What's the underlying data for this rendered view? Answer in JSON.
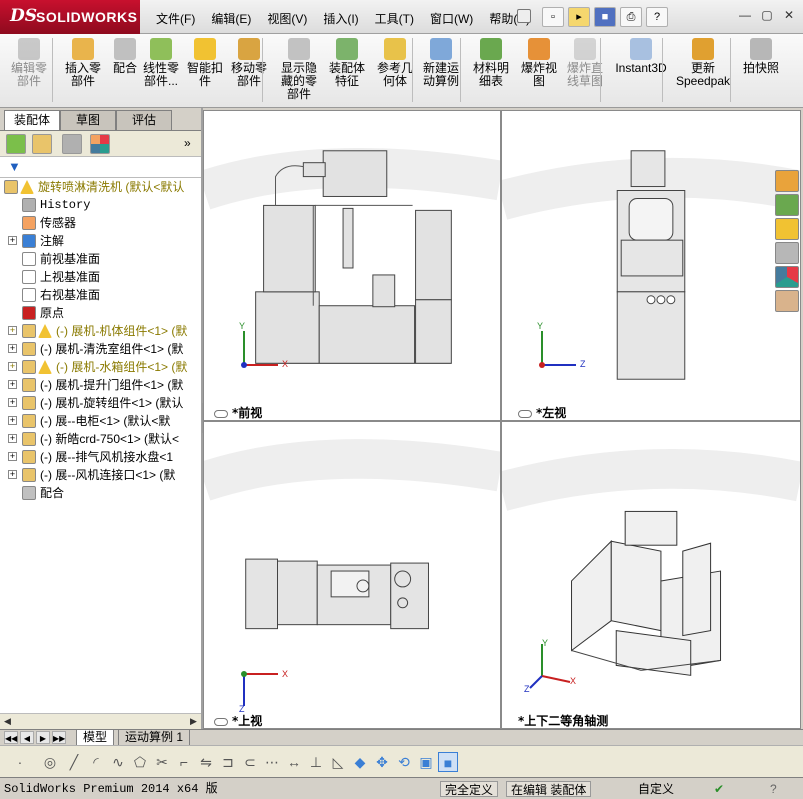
{
  "app": {
    "logo_ds": "DS",
    "logo_name": "SOLIDWORKS"
  },
  "menu": [
    "文件(F)",
    "编辑(E)",
    "视图(V)",
    "插入(I)",
    "工具(T)",
    "窗口(W)",
    "帮助(H)"
  ],
  "quick_access": [
    "new-icon",
    "open-icon",
    "save-icon",
    "print-icon",
    "help-icon"
  ],
  "window_controls": {
    "minimize": "—",
    "restore": "▢",
    "close": "✕"
  },
  "commands": [
    {
      "label": "编辑零\n部件",
      "icon": "edit-part-icon",
      "disabled": true
    },
    {
      "label": "插入零\n部件",
      "icon": "insert-part-icon",
      "disabled": false
    },
    {
      "label": "配合",
      "icon": "mate-icon",
      "disabled": false
    },
    {
      "label": "线性零\n部件...",
      "icon": "linear-pattern-icon",
      "disabled": false
    },
    {
      "label": "智能扣\n件",
      "icon": "smart-fastener-icon",
      "disabled": false
    },
    {
      "label": "移动零\n部件",
      "icon": "move-part-icon",
      "disabled": false
    },
    {
      "label": "显示隐\n藏的零\n部件",
      "icon": "show-hidden-icon",
      "disabled": false
    },
    {
      "label": "装配体\n特征",
      "icon": "assembly-feature-icon",
      "disabled": false
    },
    {
      "label": "参考几\n何体",
      "icon": "reference-geometry-icon",
      "disabled": false
    },
    {
      "label": "新建运\n动算例",
      "icon": "new-motion-study-icon",
      "disabled": false
    },
    {
      "label": "材料明\n细表",
      "icon": "bom-icon",
      "disabled": false
    },
    {
      "label": "爆炸视\n图",
      "icon": "exploded-view-icon",
      "disabled": false
    },
    {
      "label": "爆炸直\n线草图",
      "icon": "explode-line-sketch-icon",
      "disabled": true
    },
    {
      "label": "Instant3D",
      "icon": "instant3d-icon",
      "disabled": false
    },
    {
      "label": "更新\nSpeedpak",
      "icon": "speedpak-icon",
      "disabled": false
    },
    {
      "label": "拍快照",
      "icon": "snapshot-icon",
      "disabled": false
    }
  ],
  "left_tabs": [
    "装配体",
    "草图",
    "评估"
  ],
  "feature_tree": [
    {
      "label": "旋转喷淋清洗机  (默认<默认",
      "icon": "assembly-icon",
      "warn": true,
      "expand": false,
      "level": 0,
      "mono": false
    },
    {
      "label": "History",
      "icon": "history-icon",
      "warn": false,
      "expand": false,
      "level": 1,
      "mono": true
    },
    {
      "label": "传感器",
      "icon": "sensor-icon",
      "warn": false,
      "expand": false,
      "level": 1,
      "mono": false
    },
    {
      "label": "注解",
      "icon": "annotation-icon",
      "warn": false,
      "expand": true,
      "level": 1,
      "mono": false
    },
    {
      "label": "前视基准面",
      "icon": "plane-icon",
      "warn": false,
      "expand": false,
      "level": 1,
      "mono": false
    },
    {
      "label": "上视基准面",
      "icon": "plane-icon",
      "warn": false,
      "expand": false,
      "level": 1,
      "mono": false
    },
    {
      "label": "右视基准面",
      "icon": "plane-icon",
      "warn": false,
      "expand": false,
      "level": 1,
      "mono": false
    },
    {
      "label": "原点",
      "icon": "origin-icon",
      "warn": false,
      "expand": false,
      "level": 1,
      "mono": false
    },
    {
      "label": "(-) 展机-机体组件<1> (默",
      "icon": "subassembly-icon",
      "warn": true,
      "expand": true,
      "level": 1,
      "mono": false
    },
    {
      "label": "(-) 展机-清洗室组件<1> (默",
      "icon": "subassembly-icon",
      "warn": false,
      "expand": true,
      "level": 1,
      "mono": false
    },
    {
      "label": "(-) 展机-水箱组件<1> (默",
      "icon": "subassembly-icon",
      "warn": true,
      "expand": true,
      "level": 1,
      "mono": false
    },
    {
      "label": "(-) 展机-提升门组件<1> (默",
      "icon": "subassembly-icon",
      "warn": false,
      "expand": true,
      "level": 1,
      "mono": false
    },
    {
      "label": "(-) 展机-旋转组件<1> (默认",
      "icon": "subassembly-icon",
      "warn": false,
      "expand": true,
      "level": 1,
      "mono": false
    },
    {
      "label": "(-) 展--电柜<1> (默认<默",
      "icon": "subassembly-icon",
      "warn": false,
      "expand": true,
      "level": 1,
      "mono": false
    },
    {
      "label": "(-) 新皓crd-750<1> (默认<",
      "icon": "subassembly-icon",
      "warn": false,
      "expand": true,
      "level": 1,
      "mono": false
    },
    {
      "label": "(-) 展--排气风机接水盘<1",
      "icon": "subassembly-icon",
      "warn": false,
      "expand": true,
      "level": 1,
      "mono": false
    },
    {
      "label": "(-) 展--风机连接口<1> (默",
      "icon": "subassembly-icon",
      "warn": false,
      "expand": true,
      "level": 1,
      "mono": false
    },
    {
      "label": "配合",
      "icon": "mates-folder-icon",
      "warn": false,
      "expand": false,
      "level": 1,
      "mono": false
    }
  ],
  "viewports": {
    "front": "*前视",
    "left": "*左视",
    "top": "*上视",
    "iso": "*上下二等角轴测"
  },
  "axes": {
    "x": "X",
    "y": "Y",
    "z": "Z"
  },
  "model_tabs": [
    "模型",
    "运动算例 1"
  ],
  "status": {
    "version": "SolidWorks Premium 2014 x64 版",
    "constraint": "完全定义",
    "editing": "在编辑 装配体",
    "custom": "自定义"
  }
}
